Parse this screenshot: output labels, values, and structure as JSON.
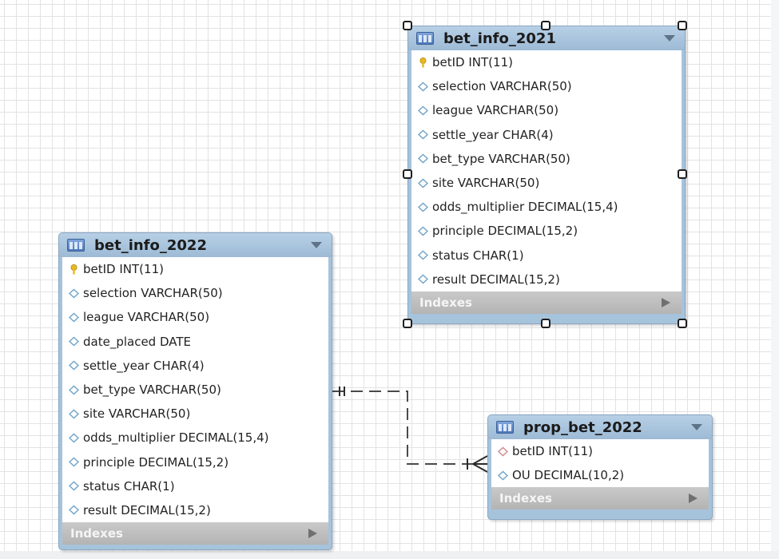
{
  "tables": [
    {
      "id": "bet_info_2021",
      "title": "bet_info_2021",
      "columns": [
        {
          "text": "betID INT(11)",
          "kind": "primary-key"
        },
        {
          "text": "selection VARCHAR(50)",
          "kind": "column"
        },
        {
          "text": "league VARCHAR(50)",
          "kind": "column"
        },
        {
          "text": "settle_year CHAR(4)",
          "kind": "column"
        },
        {
          "text": "bet_type VARCHAR(50)",
          "kind": "column"
        },
        {
          "text": "site VARCHAR(50)",
          "kind": "column"
        },
        {
          "text": "odds_multiplier DECIMAL(15,4)",
          "kind": "column"
        },
        {
          "text": "principle DECIMAL(15,2)",
          "kind": "column"
        },
        {
          "text": "status CHAR(1)",
          "kind": "column"
        },
        {
          "text": "result DECIMAL(15,2)",
          "kind": "column"
        }
      ],
      "indexes_label": "Indexes",
      "selected": true
    },
    {
      "id": "bet_info_2022",
      "title": "bet_info_2022",
      "columns": [
        {
          "text": "betID INT(11)",
          "kind": "primary-key"
        },
        {
          "text": "selection VARCHAR(50)",
          "kind": "column"
        },
        {
          "text": "league VARCHAR(50)",
          "kind": "column"
        },
        {
          "text": "date_placed DATE",
          "kind": "column"
        },
        {
          "text": "settle_year CHAR(4)",
          "kind": "column"
        },
        {
          "text": "bet_type VARCHAR(50)",
          "kind": "column"
        },
        {
          "text": "site VARCHAR(50)",
          "kind": "column"
        },
        {
          "text": "odds_multiplier DECIMAL(15,4)",
          "kind": "column"
        },
        {
          "text": "principle DECIMAL(15,2)",
          "kind": "column"
        },
        {
          "text": "status CHAR(1)",
          "kind": "column"
        },
        {
          "text": "result DECIMAL(15,2)",
          "kind": "column"
        }
      ],
      "indexes_label": "Indexes",
      "selected": false
    },
    {
      "id": "prop_bet_2022",
      "title": "prop_bet_2022",
      "columns": [
        {
          "text": "betID INT(11)",
          "kind": "foreign-key"
        },
        {
          "text": "OU DECIMAL(10,2)",
          "kind": "column"
        }
      ],
      "indexes_label": "Indexes",
      "selected": false
    }
  ],
  "relationships": [
    {
      "from": "bet_info_2022",
      "to": "prop_bet_2022",
      "from_cardinality": "one-and-only-one",
      "to_cardinality": "one-or-many",
      "style": "dashed"
    }
  ],
  "colors": {
    "header": "#a6c3dc",
    "pk_key": "#e8b820",
    "column_diamond": "#6fa3c8",
    "fk_diamond": "#d08888",
    "indexes_bar": "#bdbdbd"
  }
}
